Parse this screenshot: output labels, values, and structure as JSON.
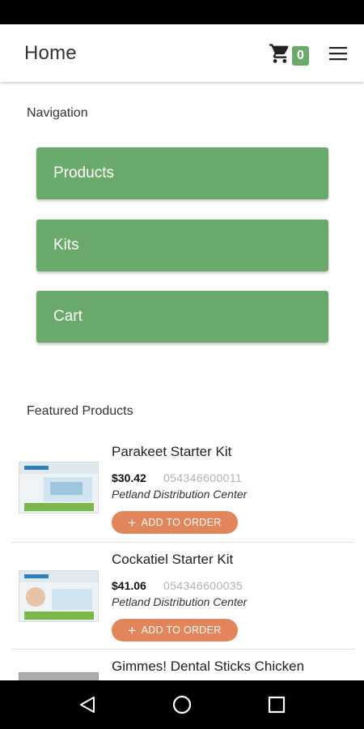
{
  "app_bar": {
    "title": "Home",
    "cart_count": "0"
  },
  "navigation": {
    "title": "Navigation",
    "buttons": [
      "Products",
      "Kits",
      "Cart"
    ]
  },
  "featured": {
    "title": "Featured Products",
    "add_label": "ADD TO ORDER",
    "items": [
      {
        "name": "Parakeet Starter Kit",
        "price": "$30.42",
        "sku": "054346600011",
        "vendor": "Petland Distribution Center"
      },
      {
        "name": "Cockatiel Starter Kit",
        "price": "$41.06",
        "sku": "054346600035",
        "vendor": "Petland Distribution Center"
      },
      {
        "name": "Gimmes! Dental Sticks Chicken"
      }
    ]
  },
  "colors": {
    "accent_green": "#6aa96a",
    "accent_orange": "#e0865a"
  },
  "icons": [
    "cart-icon",
    "menu-icon",
    "plus-icon",
    "back-icon",
    "home-icon",
    "recents-icon"
  ]
}
